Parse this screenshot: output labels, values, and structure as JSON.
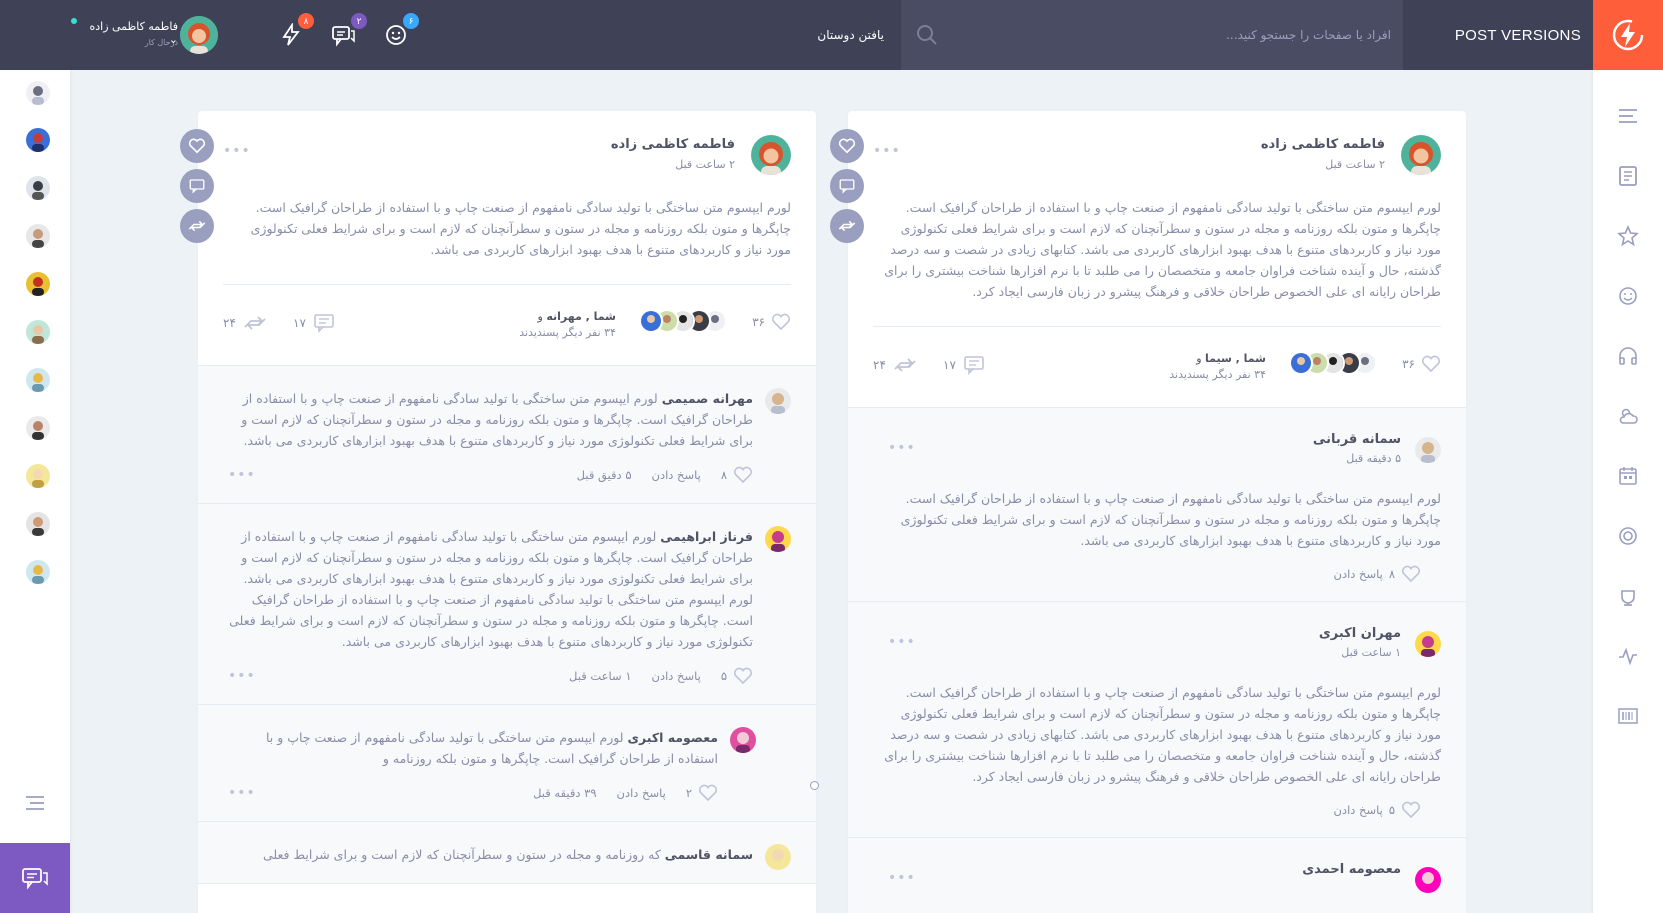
{
  "app": {
    "title": "POST VERSIONS",
    "brand_icon": "olympus-logo"
  },
  "search": {
    "placeholder": "افراد یا صفحات را جستجو کنید..."
  },
  "nav": {
    "find_friends": "یافتن دوستان"
  },
  "notifications": [
    {
      "icon": "friend-request-icon",
      "count": "۶",
      "color": "#38a9ff"
    },
    {
      "icon": "messages-icon",
      "count": "۲",
      "color": "#7c5ac2"
    },
    {
      "icon": "thunder-icon",
      "count": "۸",
      "color": "#ff5e3a"
    }
  ],
  "user": {
    "name": "فاطمه کاظمی زاده",
    "status": "درحال کار"
  },
  "left_sidebar": {
    "friends_count": 11
  },
  "columns": [
    {
      "post": {
        "author": "فاطمه کاظمی زاده",
        "time": "۲ ساعت قبل",
        "text": "لورم ایپسوم متن ساختگی با تولید سادگی نامفهوم از صنعت چاپ و با استفاده از طراحان گرافیک است. چاپگرها و متون بلکه روزنامه و مجله در ستون و سطرآنچنان که لازم است و برای شرایط فعلی تکنولوژی مورد نیاز و کاربردهای متنوع با هدف بهبود ابزارهای کاربردی می باشد. کتابهای زیادی در شصت و سه درصد گذشته، حال و آینده شناخت فراوان جامعه و متخصصان را می طلبد تا با نرم افزارها شناخت بیشتری را برای طراحان رایانه ای علی الخصوص طراحان خلاقی و فرهنگ پیشرو در زبان فارسی ایجاد کرد.",
        "likes": "۳۶",
        "likers_line1": "شما , سیما",
        "likers_and": "و",
        "likers_line2": "۳۴ نفر دیگر پسندیدند",
        "comments": "۱۷",
        "shares": "۲۴"
      },
      "comments": [
        {
          "author": "سمانه قربانی",
          "time": "۵ دقیقه قبل",
          "text": "لورم ایپسوم متن ساختگی با تولید سادگی نامفهوم از صنعت چاپ و با استفاده از طراحان گرافیک است. چاپگرها و متون بلکه روزنامه و مجله در ستون و سطرآنچنان که لازم است و برای شرایط فعلی تکنولوژی مورد نیاز و کاربردهای متنوع با هدف بهبود ابزارهای کاربردی می باشد.",
          "likes": "۸",
          "reply": "پاسخ دادن"
        },
        {
          "author": "مهران اکبری",
          "time": "۱ ساعت قبل",
          "text": "لورم ایپسوم متن ساختگی با تولید سادگی نامفهوم از صنعت چاپ و با استفاده از طراحان گرافیک است. چاپگرها و متون بلکه روزنامه و مجله در ستون و سطرآنچنان که لازم است و برای شرایط فعلی تکنولوژی مورد نیاز و کاربردهای متنوع با هدف بهبود ابزارهای کاربردی می باشد. کتابهای زیادی در شصت و سه درصد گذشته، حال و آینده شناخت فراوان جامعه و متخصصان را می طلبد تا با نرم افزارها شناخت بیشتری را برای طراحان رایانه ای علی الخصوص طراحان خلاقی و فرهنگ پیشرو در زبان فارسی ایجاد کرد.",
          "likes": "۵",
          "reply": "پاسخ دادن"
        },
        {
          "author": "معصومه احمدی",
          "time": "",
          "text": "",
          "likes": "",
          "reply": ""
        }
      ]
    },
    {
      "post": {
        "author": "فاطمه کاظمی زاده",
        "time": "۲ ساعت قبل",
        "text": "لورم ایپسوم متن ساختگی با تولید سادگی نامفهوم از صنعت چاپ و با استفاده از طراحان گرافیک است. چاپگرها و متون بلکه روزنامه و مجله در ستون و سطرآنچنان که لازم است و برای شرایط فعلی تکنولوژی مورد نیاز و کاربردهای متنوع با هدف بهبود ابزارهای کاربردی می باشد.",
        "likes": "۳۶",
        "likers_line1": "شما , مهرانه",
        "likers_and": "و",
        "likers_line2": "۳۴ نفر دیگر پسندیدند",
        "comments": "۱۷",
        "shares": "۲۴"
      },
      "comments": [
        {
          "author": "مهرانه صمیمی",
          "text": "لورم ایپسوم متن ساختگی با تولید سادگی نامفهوم از صنعت چاپ و با استفاده از طراحان گرافیک است. چاپگرها و متون بلکه روزنامه و مجله در ستون و سطرآنچنان که لازم است و برای شرایط فعلی تکنولوژی مورد نیاز و کاربردهای متنوع با هدف بهبود ابزارهای کاربردی می باشد.",
          "likes": "۸",
          "reply": "پاسخ دادن",
          "time": "۵ دقیق قبل"
        },
        {
          "author": "فرناز ابراهیمی",
          "text": "لورم ایپسوم متن ساختگی با تولید سادگی نامفهوم از صنعت چاپ و با استفاده از طراحان گرافیک است. چاپگرها و متون بلکه روزنامه و مجله در ستون و سطرآنچنان که لازم است و برای شرایط فعلی تکنولوژی مورد نیاز و کاربردهای متنوع با هدف بهبود ابزارهای کاربردی می باشد. لورم ایپسوم متن ساختگی با تولید سادگی نامفهوم از صنعت چاپ و با استفاده از طراحان گرافیک است. چاپگرها و متون بلکه روزنامه و مجله در ستون و سطرآنچنان که لازم است و برای شرایط فعلی تکنولوژی مورد نیاز و کاربردهای متنوع با هدف بهبود ابزارهای کاربردی می باشد.",
          "likes": "۵",
          "reply": "پاسخ دادن",
          "time": "۱ ساعت قبل"
        },
        {
          "author": "معصومه اکبری",
          "text": "لورم ایپسوم متن ساختگی با تولید سادگی نامفهوم از صنعت چاپ و با استفاده از طراحان گرافیک است. چاپگرها و متون بلکه روزنامه و",
          "likes": "۲",
          "reply": "پاسخ دادن",
          "time": "۳۹ دقیقه قبل"
        },
        {
          "author": "سمانه قاسمی",
          "text": "که روزنامه و مجله در ستون و سطرآنچنان که لازم است و برای شرایط فعلی",
          "likes": "",
          "reply": "",
          "time": ""
        }
      ]
    }
  ],
  "colors": {
    "topbar": "#3f4257",
    "accent": "#ff5e3a",
    "purple": "#7c5ac2",
    "blue": "#38a9ff"
  }
}
